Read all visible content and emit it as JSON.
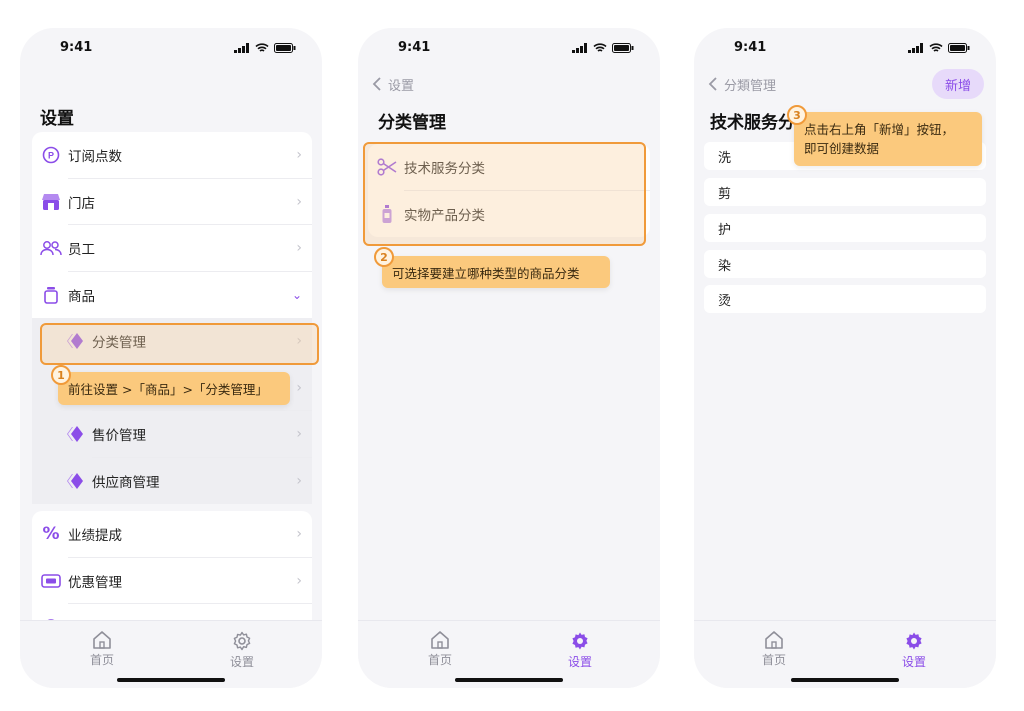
{
  "status_time": "9:41",
  "accent_color": "#8b4de8",
  "highlight_color": "#f09a3a",
  "screen1": {
    "title": "设置",
    "items": [
      {
        "label": "订阅点数",
        "icon": "points-icon"
      },
      {
        "label": "门店",
        "icon": "store-icon"
      },
      {
        "label": "员工",
        "icon": "staff-icon"
      },
      {
        "label": "商品",
        "icon": "product-icon"
      }
    ],
    "sub_items": [
      {
        "label": "分类管理"
      },
      {
        "label": "售价管理"
      },
      {
        "label": "供应商管理"
      }
    ],
    "items2": [
      {
        "label": "业绩提成",
        "icon": "percent-icon"
      },
      {
        "label": "优惠管理",
        "icon": "ticket-icon"
      },
      {
        "label": "营销"
      }
    ],
    "tip": "前往设置 >「商品」>「分类管理」",
    "badge": "1"
  },
  "screen2": {
    "back_label": "设置",
    "title": "分类管理",
    "options": [
      {
        "label": "技术服务分类",
        "icon": "scissors-icon"
      },
      {
        "label": "实物产品分类",
        "icon": "bottle-icon"
      }
    ],
    "tip": "可选择要建立哪种类型的商品分类",
    "badge": "2"
  },
  "screen3": {
    "back_label": "分類管理",
    "title": "技术服务分类",
    "new_button": "新增",
    "categories": [
      "洗",
      "剪",
      "护",
      "染",
      "烫"
    ],
    "tip_line1": "点击右上角「新增」按钮，",
    "tip_line2": "即可创建数据",
    "badge": "3"
  },
  "tabs": {
    "home": "首页",
    "settings": "设置"
  }
}
